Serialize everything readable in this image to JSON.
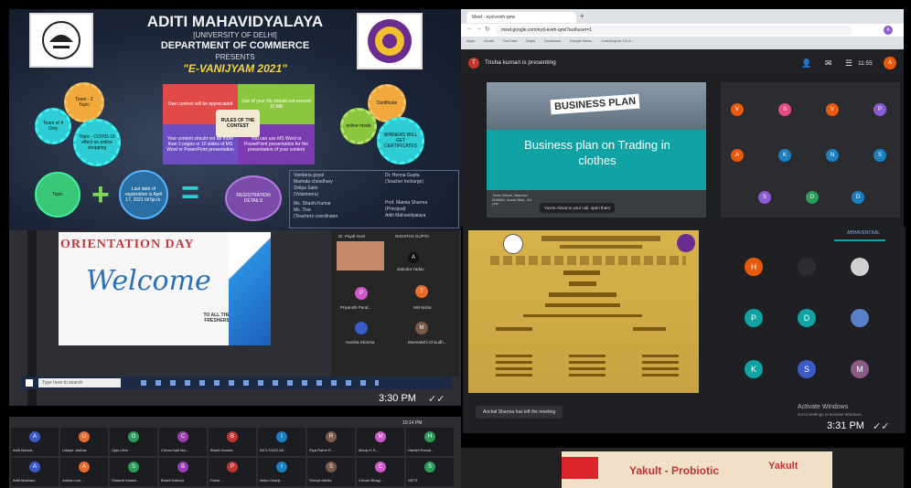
{
  "poster": {
    "college": "ADITI MAHAVIDYALAYA",
    "university": "[UNIVERSITY OF DELHI]",
    "department": "DEPARTMENT OF COMMERCE",
    "presents": "PRESENTS",
    "event": "\"E-VANIJYAM 2021\"",
    "center_label": "RULES OF THE CONTEST",
    "equals_label": "REGISTRATION DETAILS",
    "quad_texts": [
      "Own content will be appreciated",
      "Use of your file should not exceed 10 MB",
      "Your content should not be more than 3 pages or 10 slides of MS Word or PowerPoint presentation",
      "You can use MS Word or PowerPoint presentation for the presentation of your content"
    ],
    "gears_left": [
      "Team - 2 Topic",
      "Team of 4 Only",
      "Topic - COVID-19 effect on online shopping"
    ],
    "gears_right": [
      "Certificate",
      "online mode",
      "WINNERS WILL GET CERTIFICATES"
    ],
    "names_left": [
      "Vandana goyal",
      "Mamata choudhary",
      "Shilpa Saini",
      "(Volunteers)"
    ],
    "names_right": [
      "Dr. Henna Gupta",
      "(Teacher Incharge)"
    ],
    "names_left2": [
      "Ms. Shashi Kumar",
      "Ms. Tisa",
      "(Teachers coordinator"
    ],
    "names_right2": [
      "Prof. Mamta Sharma",
      "(Principal)",
      "Aditi Mahavidyalaya"
    ],
    "plus_text": "Last date of registration is April 17, 2021 till 5p.m."
  },
  "orientation": {
    "title": "ORIENTATION DAY",
    "welcome": "Welcome",
    "sub": "TO ALL THE FRESHERS",
    "time": "3:30 PM",
    "search_placeholder": "Type here to search",
    "participants": [
      {
        "name": "Dr. Payal Goel",
        "initial": ""
      },
      {
        "name": "NISHITHA GUPTA",
        "initial": ""
      },
      {
        "name": "Jatindra Yadav",
        "initial": ""
      },
      {
        "name": "",
        "initial": "A"
      },
      {
        "name": "Priyanshi Pand...",
        "initial": "P"
      },
      {
        "name": "Mili Nisha",
        "initial": "T"
      },
      {
        "name": "Harsha Sharma",
        "initial": ""
      },
      {
        "name": "Meenakshi Choudh...",
        "initial": "M"
      }
    ]
  },
  "gallery": {
    "time": "10:14 PM",
    "names": [
      "Aditi Mahad...",
      "Udaykr Jadhav",
      "Ojas Lifhe",
      "Chhavi Aali Ma...",
      "Bharti Harsha",
      "INCLTOGS AE...",
      "Riya Rathe R...",
      "Manju K.S...",
      "Harishi Ramal...",
      "Aditi Madhavi...",
      "Adrika Loni...",
      "Shaanti Kalami...",
      "Bharti Kalfond",
      "Pahal...",
      "Ishita Giranji...",
      "Shreyti Adelia",
      "Chhavi Bhagi...",
      "SBTS"
    ]
  },
  "meet": {
    "tab_title": "Meet - eyd-eveh-qew",
    "url": "meet.google.com/eyd-eveh-qew?authuser=1",
    "presenting": "Trisha kumari is presenting",
    "time": "11:55",
    "bookmarks": [
      "Apps",
      "Gmail",
      "YouTube",
      "Maps",
      "Download",
      "Google News",
      "Coaching for CA &..."
    ],
    "slide_heading": "BUSINESS PLAN",
    "slide_title": "Business plan on Trading in clothes",
    "slide_names": "Trisha Gilbarti, Vaishnavi DHIMAN, Kumari Beta - 3rd year",
    "toast": "You're About to your call, open them",
    "participants": [
      "V",
      "S",
      "V",
      "P",
      "A",
      "K",
      "N",
      "S",
      "S",
      "D",
      "D"
    ]
  },
  "meet2": {
    "notification": "Anchal Sharma has left the meeting",
    "activate_title": "Activate Windows",
    "activate_sub": "Go to Settings to activate Windows.",
    "time": "3:31 PM",
    "top_name": "ABHAVENTKAL",
    "participants": [
      "H",
      "",
      "",
      "",
      "P",
      "D",
      "",
      "",
      "K",
      "S",
      "M",
      ""
    ]
  },
  "yakult": {
    "title": "Yakult - Probiotic",
    "brand": "Yakult"
  },
  "colors": {
    "meet_purple": "#8a5cd1",
    "teal": "#0fa3a3",
    "gold": "#f5d43a"
  }
}
